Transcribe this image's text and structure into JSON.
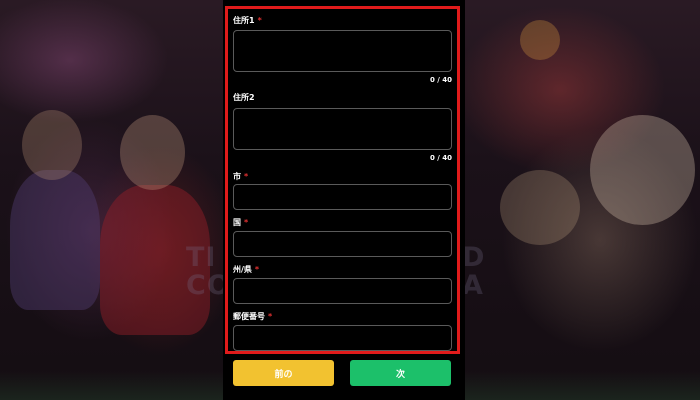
{
  "background": {
    "text_left_line1": "TI",
    "text_left_line2": "CO",
    "text_right_line1": "D",
    "text_right_line2": "A"
  },
  "form": {
    "address1": {
      "label": "住所1",
      "required_mark": "*",
      "value": "",
      "counter": "0 / 40"
    },
    "address2": {
      "label": "住所2",
      "value": "",
      "counter": "0 / 40"
    },
    "city": {
      "label": "市",
      "required_mark": "*",
      "value": ""
    },
    "country": {
      "label": "国",
      "required_mark": "*",
      "value": ""
    },
    "state": {
      "label": "州/県",
      "required_mark": "*",
      "value": ""
    },
    "postal_code": {
      "label": "郵便番号",
      "required_mark": "*",
      "value": ""
    }
  },
  "buttons": {
    "back_label": "前の",
    "next_label": "次"
  },
  "colors": {
    "back_button": "#f2c230",
    "next_button": "#1cc06a",
    "required": "#e03131",
    "highlight_border": "#e01b1b"
  }
}
